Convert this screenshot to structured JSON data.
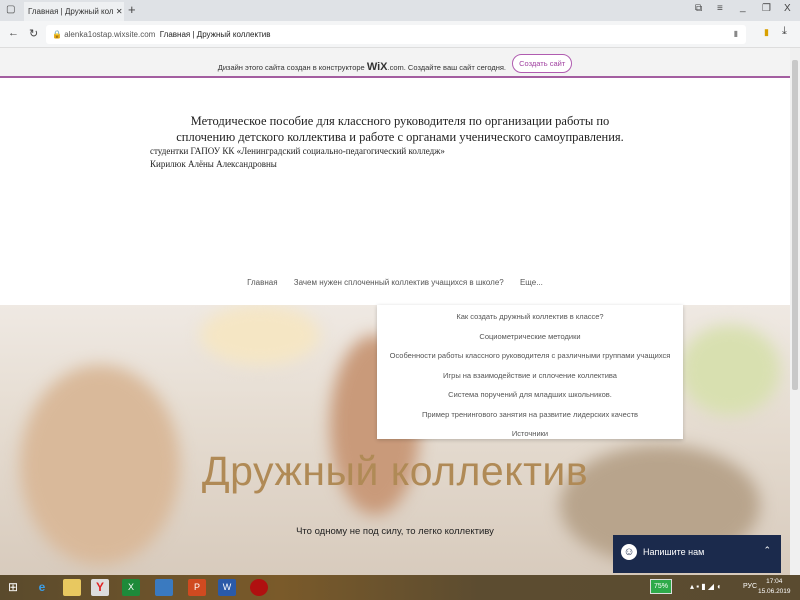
{
  "browser": {
    "tab_title": "Главная | Дружный кол",
    "url_domain": "alenka1ostap.wixsite.com",
    "page_title": "Главная | Дружный коллектив"
  },
  "banner": {
    "text_before": "Дизайн этого сайта создан в конструкторе",
    "wix": "WiX",
    "text_after": ".com. Создайте ваш сайт сегодня.",
    "button": "Создать сайт"
  },
  "header": {
    "title": "Методическое пособие для классного руководителя по организации работы по сплочению детского коллектива и работе с органами ученического самоуправления.",
    "line1": "студентки ГАПОУ КК «Ленинградский социально-педагогический колледж»",
    "line2": "Кирилюк Алёны Александровны"
  },
  "nav": {
    "items": [
      "Главная",
      "Зачем нужен сплоченный коллектив учащихся в школе?",
      "Еще..."
    ]
  },
  "dropdown": {
    "items": [
      "Как создать дружный коллектив в классе?",
      "Социометрические методики",
      "Особенности работы классного руководителя с различными группами учащихся",
      "Игры на взаимодействие и сплочение коллектива",
      "Система поручений для младших школьников.",
      "Пример тренингового занятия на развитие лидерских качеств",
      "Источники"
    ]
  },
  "hero": {
    "title": "Дружный коллектив",
    "subtitle": "Что одному не под силу, то легко коллективу"
  },
  "chat": {
    "label": "Напишите нам"
  },
  "taskbar": {
    "battery": "75%",
    "lang": "РУС",
    "time": "17:04",
    "date": "15.06.2019"
  }
}
